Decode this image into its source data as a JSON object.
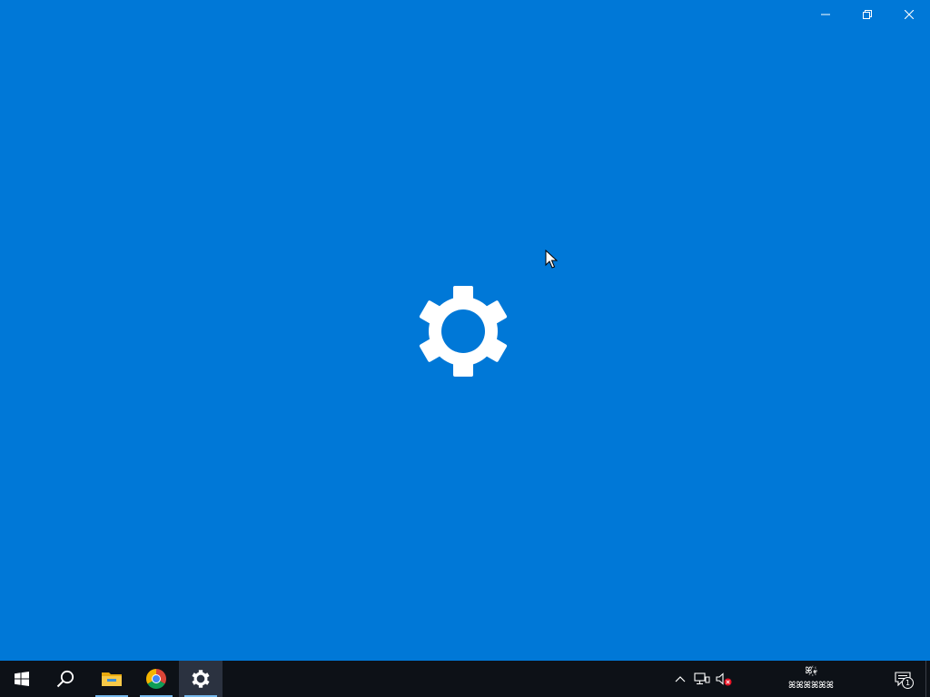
{
  "app_window": {
    "caption_buttons": [
      {
        "name": "minimize",
        "icon": "minimize-icon"
      },
      {
        "name": "restore",
        "icon": "restore-icon"
      },
      {
        "name": "close",
        "icon": "close-icon"
      }
    ],
    "splash_icon": "gear-icon",
    "background_color": "#0078d7"
  },
  "taskbar": {
    "pinned": [
      {
        "name": "start",
        "icon": "windows-logo-icon"
      },
      {
        "name": "search",
        "icon": "search-icon"
      },
      {
        "name": "file-explorer",
        "icon": "folder-icon",
        "running": true
      },
      {
        "name": "chrome",
        "icon": "chrome-icon",
        "running": true
      },
      {
        "name": "settings",
        "icon": "gear-icon",
        "running": true,
        "active": true
      }
    ],
    "tray": {
      "icons": [
        "chevron-up-icon",
        "network-icon",
        "volume-muted-icon"
      ],
      "clock_line1": "ꕤ꙰꘎",
      "clock_line2": "ꕤꕤꕤꕤꕤꕤ",
      "notification_count": "1"
    },
    "accent_color": "#76b9ed"
  }
}
